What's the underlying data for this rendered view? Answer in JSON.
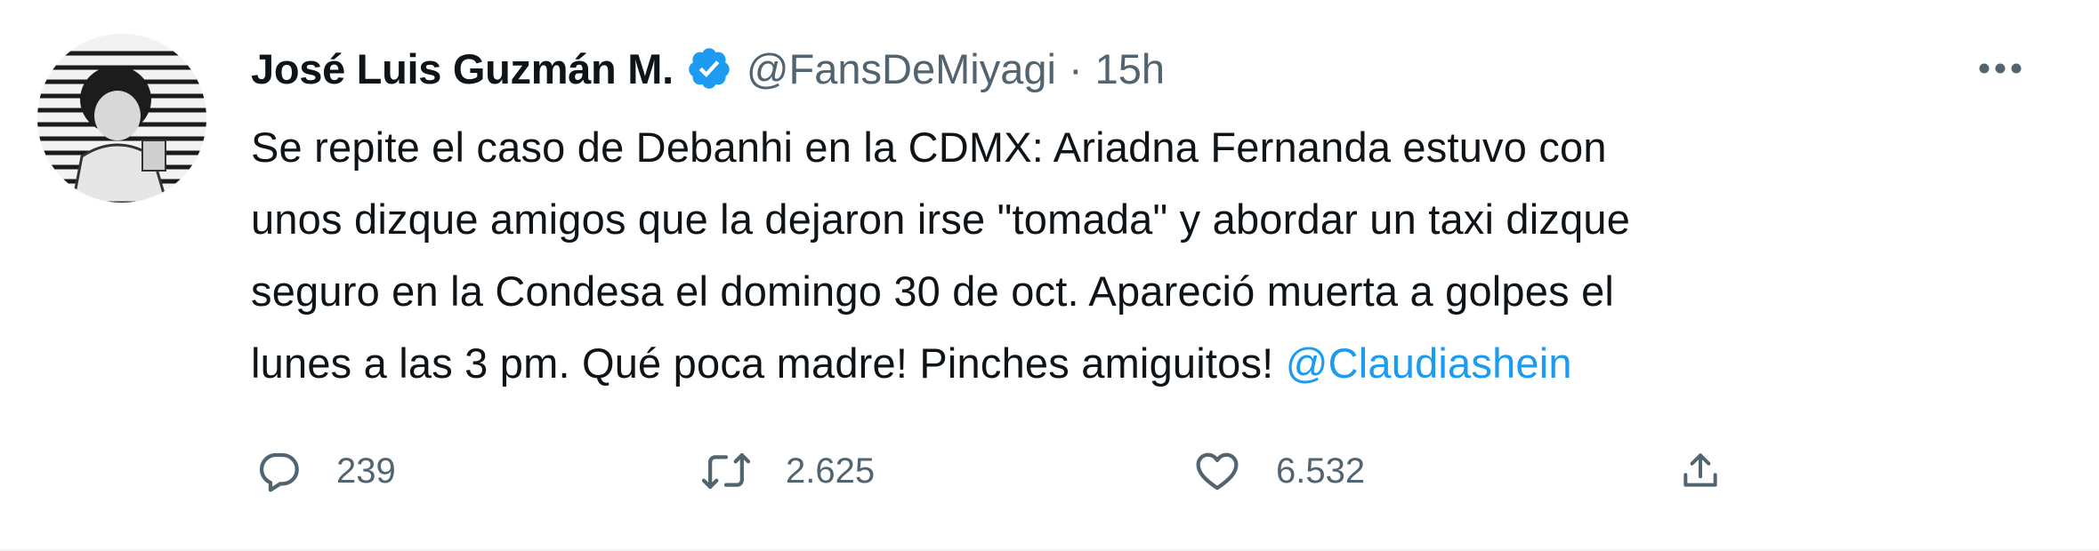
{
  "tweet": {
    "author": {
      "name": "José Luis Guzmán M.",
      "handle": "@FansDeMiyagi",
      "separator": "·",
      "time": "15h",
      "verified": true
    },
    "text": {
      "line1": "Se repite el caso de Debanhi en la CDMX: Ariadna Fernanda estuvo con",
      "line2": "unos dizque amigos que la dejaron irse \"tomada\" y abordar un taxi dizque",
      "line3": "seguro en la Condesa el domingo 30 de oct. Apareció muerta a golpes el",
      "line4": "lunes a las 3 pm. Qué poca madre! Pinches amiguitos! ",
      "mention": "@Claudiashein"
    },
    "actions": {
      "replies": "239",
      "retweets": "2.625",
      "likes": "6.532"
    }
  },
  "colors": {
    "text": "#0f1419",
    "secondary": "#536471",
    "accent": "#1d9bf0"
  },
  "icons": {
    "verified": "verified-badge-icon",
    "more": "more-options-icon",
    "reply": "reply-icon",
    "retweet": "retweet-icon",
    "like": "heart-icon",
    "share": "share-icon"
  }
}
